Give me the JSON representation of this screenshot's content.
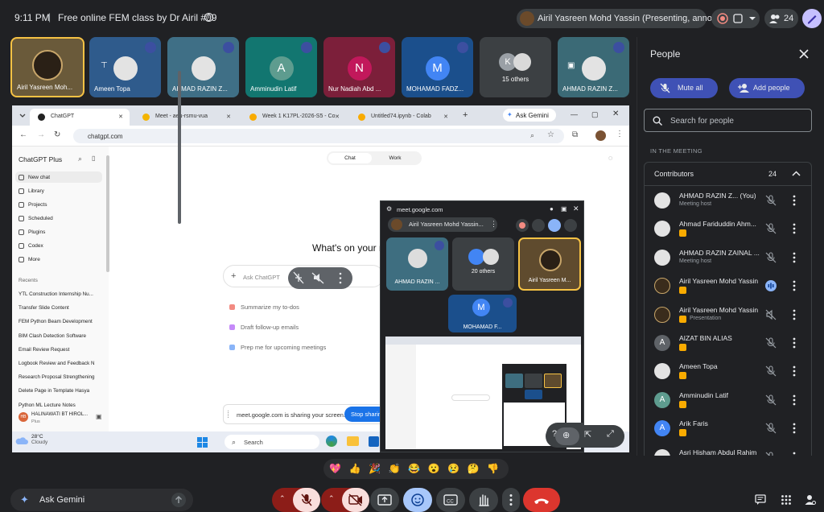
{
  "topbar": {
    "time": "9:11 PM",
    "separator": "|",
    "title": "Free online FEM class by Dr Airil #09",
    "presenter": "Airil Yasreen Mohd Yassin (Presenting, annotating)",
    "participant_count": "24"
  },
  "filmstrip": [
    {
      "name": "Airil Yasreen Moh...",
      "kind": "photo-dark",
      "border": "#f6c244",
      "bg": "#6a5a3a"
    },
    {
      "name": "Ameen Topa",
      "kind": "photo",
      "bg": "#2f5b8c"
    },
    {
      "name": "AHMAD RAZIN Z...",
      "kind": "photo",
      "bg": "#3f6f86"
    },
    {
      "name": "Amminudin Latif",
      "kind": "letter",
      "letter": "A",
      "bg": "#127670",
      "avatar": "#5e9c8f"
    },
    {
      "name": "Nur Nadiah Abd ...",
      "kind": "letter",
      "letter": "N",
      "bg": "#7c1f3a",
      "avatar": "#c2185b"
    },
    {
      "name": "MOHAMAD FADZ...",
      "kind": "letter",
      "letter": "M",
      "bg": "#1b4f8c",
      "avatar": "#4285f4"
    },
    {
      "name": "15 others",
      "kind": "others",
      "letter": "K",
      "bg": "#3c4043"
    },
    {
      "name": "AHMAD RAZIN Z...",
      "kind": "photo",
      "bg": "#3b6a76"
    }
  ],
  "browser": {
    "tabs": [
      {
        "label": "ChatGPT",
        "active": true,
        "color": "#222"
      },
      {
        "label": "Meet - aeu-rsmu-vua",
        "active": false,
        "color": "#f4b400"
      },
      {
        "label": "Week 1 K17PL-2026-S5 - Co",
        "active": false,
        "color": "#f9ab00"
      },
      {
        "label": "Untitled74.ipynb - Colab",
        "active": false,
        "color": "#f9ab00"
      }
    ],
    "ask_gemini": "Ask Gemini",
    "url": "chatgpt.com"
  },
  "chatgpt": {
    "brand": "ChatGPT Plus",
    "nav": [
      "New chat",
      "Library",
      "Projects",
      "Scheduled",
      "Plugins",
      "Codex",
      "More"
    ],
    "recents_label": "Recents",
    "recents": [
      "YTL Construction Internship  Nu...",
      "Transfer Slide Content",
      "FEM Python Beam Development",
      "BIM Clash Detection Software",
      "Email Review Request",
      "Logbook Review and Feedback  N",
      "Research Proposal Strengthening",
      "Delete Page in Template  Hasya",
      "Python ML Lecture Notes"
    ],
    "user_initials": "HB",
    "user_name": "HALINAWATI BT HIROL...",
    "user_plan": "Plus",
    "mode_chat": "Chat",
    "mode_work": "Work",
    "headline": "What's on your m",
    "ask_placeholder": "Ask ChatGPT",
    "suggestions": [
      {
        "label": "Summarize my to-dos",
        "color": "#f28b82"
      },
      {
        "label": "Draft follow-up emails",
        "color": "#c58af9"
      },
      {
        "label": "Prep me for upcoming meetings",
        "color": "#8ab4f8"
      }
    ],
    "share_notice": "meet.google.com is sharing your screen.",
    "stop_sharing": "Stop sharing"
  },
  "taskbar": {
    "temp": "28°C",
    "weather": "Cloudy",
    "search": "Search"
  },
  "popup": {
    "url": "meet.google.com",
    "presenter": "Airil Yasreen Mohd Yassin...",
    "tiles": [
      {
        "name": "AHMAD RAZIN ..."
      },
      {
        "name": "20 others"
      },
      {
        "name": "Airil Yasreen M..."
      },
      {
        "name": "MOHAMAD F...",
        "letter": "M"
      }
    ]
  },
  "people": {
    "title": "People",
    "mute_all": "Mute all",
    "add_people": "Add people",
    "search_placeholder": "Search for people",
    "in_meeting": "IN THE MEETING",
    "contributors": "Contributors",
    "count": "24",
    "list": [
      {
        "name": "AHMAD RAZIN Z...  (You)",
        "sub": "Meeting host",
        "avatar": "photo",
        "badge": false,
        "mic": "muted"
      },
      {
        "name": "Ahmad Fariduddin Ahm...",
        "sub": "",
        "avatar": "photo",
        "badge": true,
        "mic": "muted"
      },
      {
        "name": "AHMAD RAZIN ZAINAL ...",
        "sub": "Meeting host",
        "avatar": "photo",
        "badge": false,
        "mic": "muted"
      },
      {
        "name": "Airil Yasreen Mohd Yassin",
        "sub": "",
        "avatar": "photo-dark",
        "badge": true,
        "mic": "speaking"
      },
      {
        "name": "Airil Yasreen Mohd Yassin",
        "sub": "Presentation",
        "avatar": "photo-dark",
        "badge": true,
        "mic": "presentation"
      },
      {
        "name": "AIZAT BIN ALIAS",
        "sub": "",
        "avatar": "letter",
        "letter": "A",
        "avcolor": "#5f6368",
        "badge": true,
        "mic": "muted"
      },
      {
        "name": "Ameen Topa",
        "sub": "",
        "avatar": "photo",
        "badge": true,
        "mic": "muted"
      },
      {
        "name": "Amminudin Latif",
        "sub": "",
        "avatar": "letter",
        "letter": "A",
        "avcolor": "#5e9c8f",
        "badge": true,
        "mic": "muted"
      },
      {
        "name": "Arik Faris",
        "sub": "",
        "avatar": "letter",
        "letter": "A",
        "avcolor": "#4285f4",
        "badge": true,
        "mic": "muted"
      },
      {
        "name": "Asri Hisham Abdul Rahim",
        "sub": "",
        "avatar": "photo",
        "badge": false,
        "mic": "muted"
      }
    ]
  },
  "reactions": [
    "💖",
    "👍",
    "🎉",
    "👏",
    "😂",
    "😮",
    "😢",
    "🤔",
    "👎"
  ],
  "bottom": {
    "ask_gemini": "Ask Gemini"
  }
}
